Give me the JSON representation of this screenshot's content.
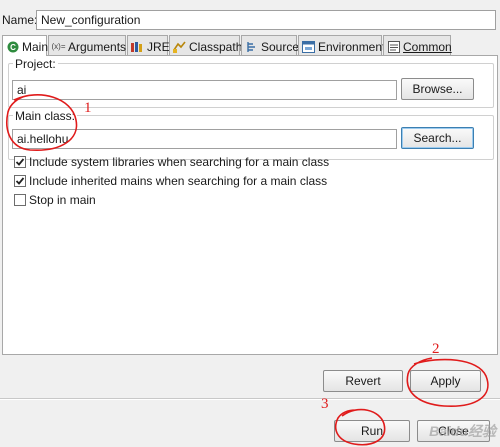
{
  "name_row": {
    "label": "Name:",
    "value": "New_configuration"
  },
  "tabs": [
    {
      "label": "Main",
      "icon": "main-class-icon"
    },
    {
      "label": "Arguments",
      "icon": "arguments-icon"
    },
    {
      "label": "JRE",
      "icon": "jre-books-icon"
    },
    {
      "label": "Classpath",
      "icon": "classpath-icon"
    },
    {
      "label": "Source",
      "icon": "source-icon"
    },
    {
      "label": "Environment",
      "icon": "environment-icon"
    },
    {
      "label": "Common",
      "icon": "common-icon"
    }
  ],
  "project": {
    "title": "Project:",
    "value": "ai",
    "browse_label": "Browse..."
  },
  "main_class": {
    "title": "Main class:",
    "value": "ai.hellohu",
    "search_label": "Search..."
  },
  "options": [
    {
      "label": "Include system libraries when searching for a main class",
      "checked": true
    },
    {
      "label": "Include inherited mains when searching for a main class",
      "checked": true
    },
    {
      "label": "Stop in main",
      "checked": false
    }
  ],
  "buttons": {
    "revert": "Revert",
    "apply": "Apply",
    "run": "Run",
    "close": "Close"
  },
  "annotations": [
    "1",
    "2",
    "3"
  ],
  "watermark": "Baidu经验",
  "colors": {
    "annotation": "#e01b1b",
    "focus_border": "#3c7fb1",
    "panel_bg": "#ffffff",
    "window_bg": "#f0f0f0"
  }
}
